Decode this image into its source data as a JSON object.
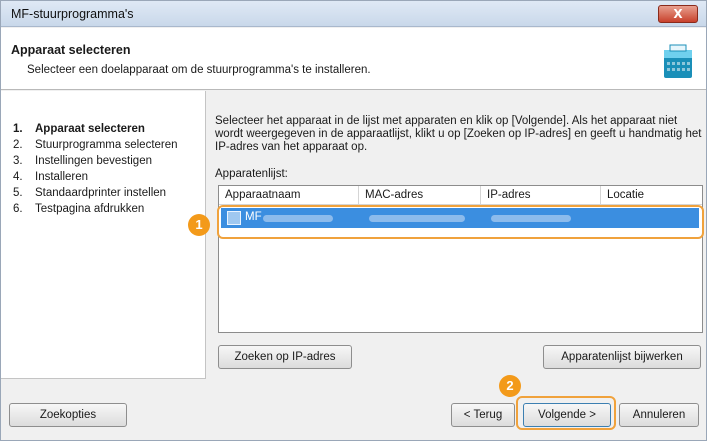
{
  "window": {
    "title": "MF-stuurprogramma's",
    "close_label": "X"
  },
  "header": {
    "title": "Apparaat selecteren",
    "subtitle": "Selecteer een doelapparaat om de stuurprogramma's te installeren."
  },
  "steps": [
    {
      "num": "1.",
      "label": "Apparaat selecteren",
      "active": true
    },
    {
      "num": "2.",
      "label": "Stuurprogramma selecteren",
      "active": false
    },
    {
      "num": "3.",
      "label": "Instellingen bevestigen",
      "active": false
    },
    {
      "num": "4.",
      "label": "Installeren",
      "active": false
    },
    {
      "num": "5.",
      "label": "Standaardprinter instellen",
      "active": false
    },
    {
      "num": "6.",
      "label": "Testpagina afdrukken",
      "active": false
    }
  ],
  "content": {
    "instruction": "Selecteer het apparaat in de lijst met apparaten en klik op [Volgende]. Als het apparaat niet wordt weergegeven in de apparaatlijst, klikt u op [Zoeken op IP-adres] en geeft u handmatig het IP-adres van het apparaat op.",
    "list_label": "Apparatenlijst:",
    "columns": [
      "Apparaatnaam",
      "MAC-adres",
      "IP-adres",
      "Locatie"
    ],
    "rows": [
      {
        "name": "MF",
        "selected": true
      }
    ],
    "search_ip_button": "Zoeken op IP-adres",
    "refresh_button": "Apparatenlijst bijwerken"
  },
  "footer": {
    "readme_button": "Zoekopties",
    "back_button": "< Terug",
    "next_button": "Volgende >",
    "cancel_button": "Annuleren"
  },
  "callouts": {
    "row": "1",
    "next": "2"
  },
  "colors": {
    "callout": "#f39a1a",
    "selection": "#3b8ee0",
    "title_bar": "#c9d8ea"
  }
}
